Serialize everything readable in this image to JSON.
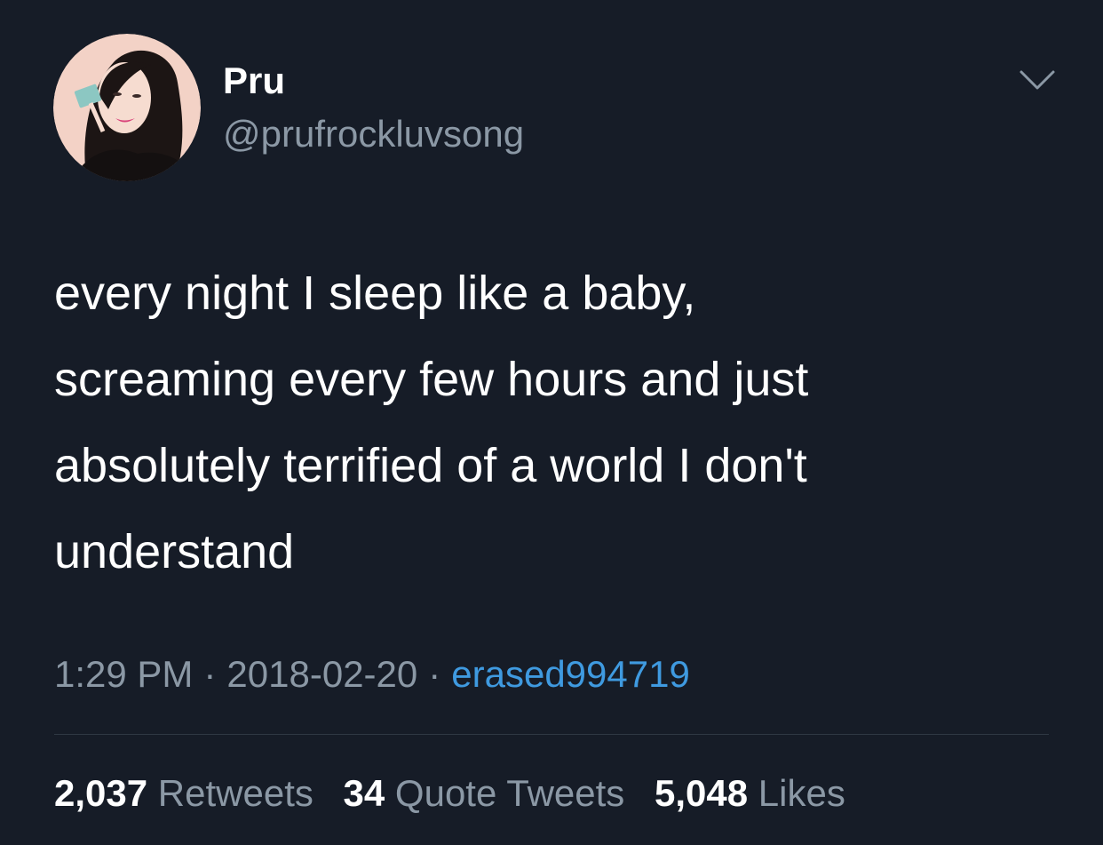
{
  "user": {
    "display_name": "Pru",
    "handle": "@prufrockluvsong",
    "avatar_icon": "profile-photo"
  },
  "menu": {
    "icon": "chevron-down-icon"
  },
  "tweet": {
    "text": "every night I sleep like a baby,\nscreaming every few hours and just\nabsolutely terrified of a world I don't\nunderstand"
  },
  "meta": {
    "time": "1:29 PM",
    "separator": "·",
    "date": "2018-02-20",
    "source": "erased994719"
  },
  "stats": {
    "retweets_count": "2,037",
    "retweets_label": "Retweets",
    "quotes_count": "34",
    "quotes_label": "Quote Tweets",
    "likes_count": "5,048",
    "likes_label": "Likes"
  },
  "colors": {
    "background": "#161c27",
    "text": "#ffffff",
    "secondary_text": "#8b98a5",
    "link": "#3f9ae0",
    "divider": "#2f3843"
  }
}
